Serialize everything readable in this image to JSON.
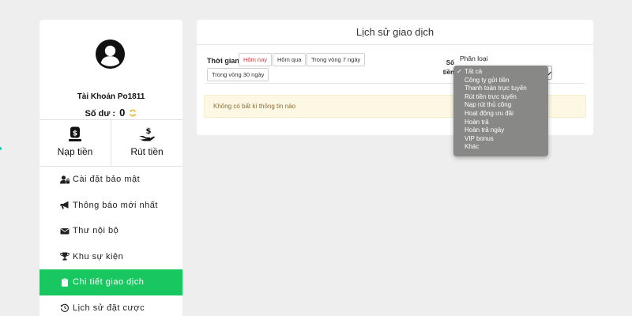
{
  "sidebar": {
    "account_name": "Tài Khoản Po1811",
    "balance_label": "Số dư :",
    "balance_value": "0",
    "deposit_label": "Nạp tiền",
    "withdraw_label": "Rút tiền",
    "menu": [
      {
        "label": "Cài đặt bảo mật",
        "icon": "user-lock-icon"
      },
      {
        "label": "Thông báo mới nhất",
        "icon": "bullhorn-icon"
      },
      {
        "label": "Thư nội bộ",
        "icon": "envelope-icon"
      },
      {
        "label": "Khu sự kiện",
        "icon": "trophy-icon"
      },
      {
        "label": "Chi tiết giao dịch",
        "icon": "clipboard-icon",
        "active": true
      },
      {
        "label": "Lịch sử đặt cược",
        "icon": "history-icon"
      }
    ]
  },
  "panel": {
    "title": "Lịch sử giao dịch",
    "time_label": "Thời gian",
    "time_buttons": [
      "Hôm nay",
      "Hôm qua",
      "Trong vòng 7 ngày",
      "Trong vòng 30 ngày"
    ],
    "active_time": "Hôm nay",
    "amount_label_line1": "Số",
    "amount_label_line2": "tiền",
    "category_label": "Phân loại",
    "empty_message": "Không có bất kì thông tin nào"
  },
  "dropdown": {
    "selected": "Tất cả",
    "options": [
      "Tất cả",
      "Công ty gửi tiền",
      "Thanh toán trực tuyến",
      "Rút tiền trực tuyến",
      "Nạp rút thủ công",
      "Hoạt động ưu đãi",
      "Hoàn trả",
      "Hoàn trả ngày",
      "VIP bonus",
      "Khác"
    ]
  },
  "colors": {
    "accent_green": "#19c761",
    "active_time_text": "#d23a3a",
    "refresh_icon": "#f0b323",
    "dropdown_bg": "#888886",
    "notice_bg": "#fcf8e3"
  }
}
